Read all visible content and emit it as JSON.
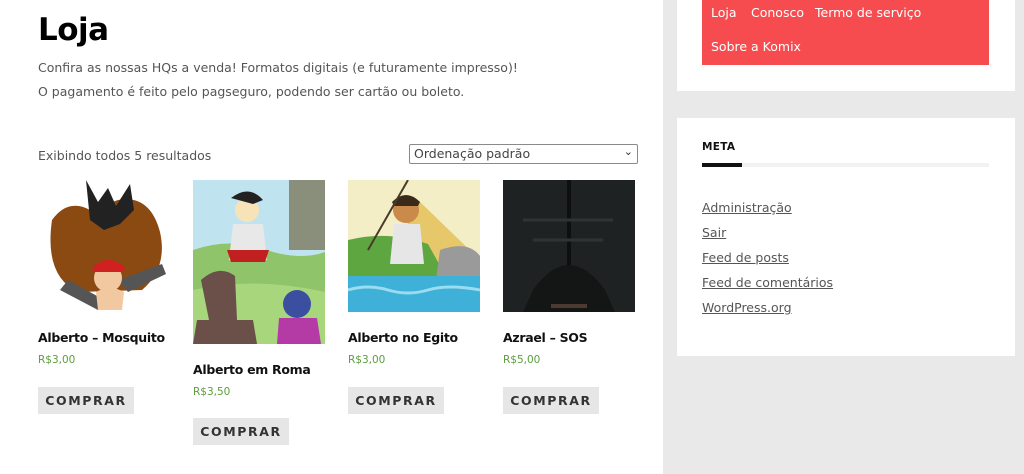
{
  "shop": {
    "title": "Loja",
    "intro_1": "Confira as nossas HQs a venda! Formatos digitais (e futuramente impresso)!",
    "intro_2": "O pagamento é feito pelo pagseguro, podendo ser cartão ou boleto.",
    "result_count": "Exibindo todos 5 resultados",
    "sort": {
      "selected": "Ordenação padrão"
    }
  },
  "products": [
    {
      "name": "Alberto – Mosquito",
      "price": "R$3,00",
      "buy_label": "COMPRAR"
    },
    {
      "name": "Alberto em Roma",
      "price": "R$3,50",
      "buy_label": "COMPRAR"
    },
    {
      "name": "Alberto no Egito",
      "price": "R$3,00",
      "buy_label": "COMPRAR"
    },
    {
      "name": "Azrael – SOS",
      "price": "R$5,00",
      "buy_label": "COMPRAR"
    }
  ],
  "nav": {
    "items": [
      "Loja",
      "Conosco",
      "Termo de serviço",
      "Sobre a Komix"
    ],
    "background": "#f74c4f"
  },
  "meta": {
    "title": "META",
    "links": [
      "Administração",
      "Sair",
      "Feed de posts",
      "Feed de comentários",
      "WordPress.org"
    ]
  },
  "colors": {
    "price": "#5c9e3d",
    "accent": "#f74c4f"
  }
}
